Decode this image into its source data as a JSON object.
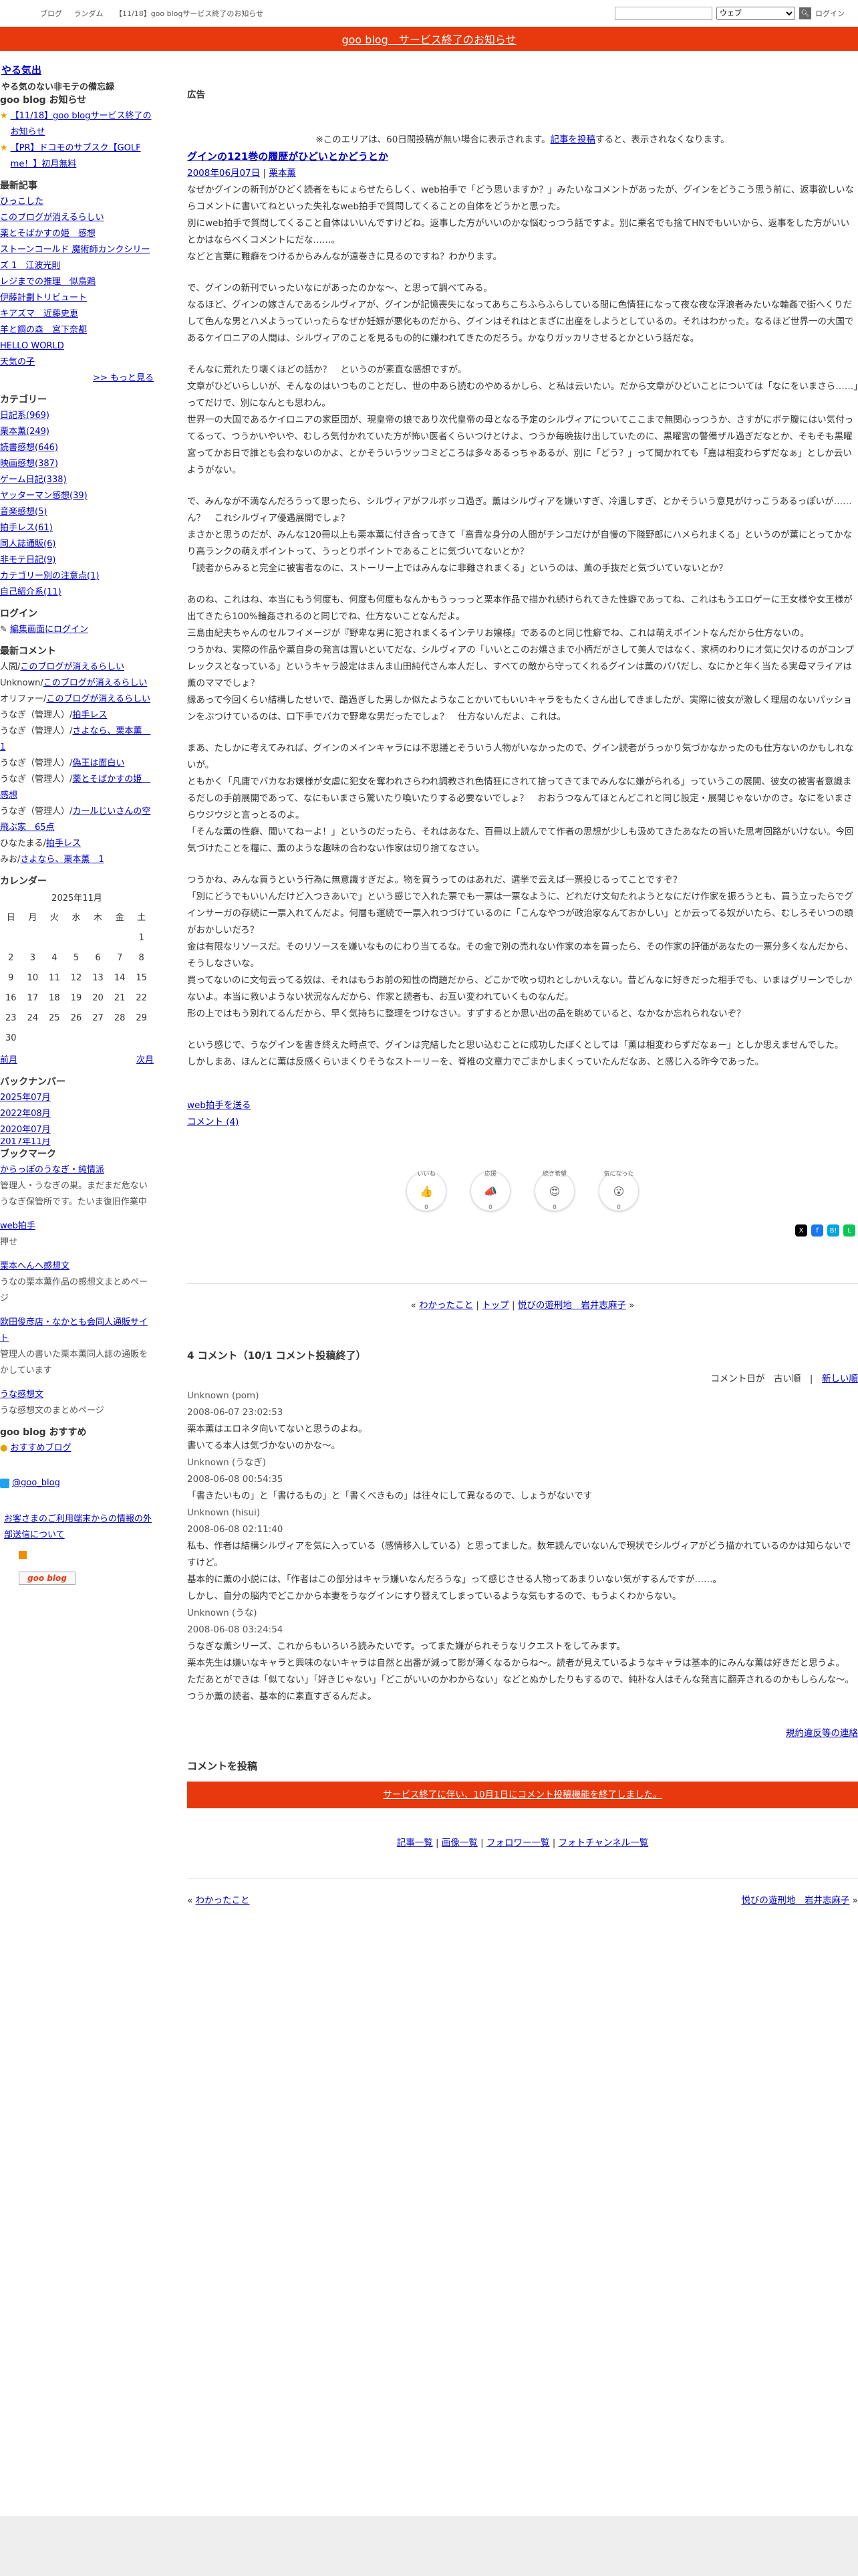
{
  "topbar": {
    "links": [
      "ブログ",
      "ランダム",
      "【11/18】goo blogサービス終了のお知らせ"
    ],
    "search_placeholder": "",
    "select_value": "ウェブ",
    "login": "ログイン"
  },
  "banner": {
    "text": "goo blog　サービス終了のお知らせ"
  },
  "blog": {
    "title": "やる気出",
    "description": "やる気のない非モテの備忘録"
  },
  "sidebar": {
    "notice_heading": "goo blog お知らせ",
    "notices": [
      "【11/18】goo blogサービス終了のお知らせ",
      "【PR】ドコモのサブスク【GOLF me！】初月無料"
    ],
    "recent_heading": "最新記事",
    "recent": [
      "ひっこした",
      "このブログが消えるらしい",
      "薬とそばかすの姫　感想",
      "ストーンコールド 魔術師カンクシリーズ 1　江波光則",
      "レジまでの推理　似鳥鶏",
      "伊藤計劃トリビュート",
      "キアズマ　近藤史恵",
      "羊と鋼の森　宮下奈都",
      "HELLO WORLD",
      "天気の子"
    ],
    "more": ">> もっと見る",
    "category_heading": "カテゴリー",
    "categories": [
      "日記系(969)",
      "栗本薫(249)",
      "読書感想(646)",
      "映画感想(387)",
      "ゲーム日記(338)",
      "ヤッターマン感想(39)",
      "音楽感想(5)",
      "拍手レス(61)",
      "同人誌通販(6)",
      "非モテ日記(9)",
      "カテゴリー別の注意点(1)",
      "自己紹介系(11)"
    ],
    "login_heading": "ログイン",
    "login_link": "編集画面にログイン",
    "comments_heading": "最新コメント",
    "comments": [
      {
        "who": "人間/",
        "link": "このブログが消えるらしい"
      },
      {
        "who": "Unknown/",
        "link": "このブログが消えるらしい"
      },
      {
        "who": "オリファー/",
        "link": "このブログが消えるらしい"
      },
      {
        "who": "うなぎ（管理人）/",
        "link": "拍手レス"
      },
      {
        "who": "うなぎ（管理人）/",
        "link": "さよなら、栗本薫　1"
      },
      {
        "who": "うなぎ（管理人）/",
        "link": "偽王は面白い"
      },
      {
        "who": "うなぎ（管理人）/",
        "link": "薬とそばかすの姫　感想"
      },
      {
        "who": "うなぎ（管理人）/",
        "link": "カールじいさんの空飛ぶ家　65点"
      },
      {
        "who": "ひなたまる/",
        "link": "拍手レス"
      },
      {
        "who": "みお/",
        "link": "さよなら、栗本薫　1"
      }
    ],
    "calendar_heading": "カレンダー",
    "calendar_month": "2025年11月",
    "calendar_days": [
      "日",
      "月",
      "火",
      "水",
      "木",
      "金",
      "土"
    ],
    "calendar_rows": [
      [
        "",
        "",
        "",
        "",
        "",
        "",
        "1"
      ],
      [
        "2",
        "3",
        "4",
        "5",
        "6",
        "7",
        "8"
      ],
      [
        "9",
        "10",
        "11",
        "12",
        "13",
        "14",
        "15"
      ],
      [
        "16",
        "17",
        "18",
        "19",
        "20",
        "21",
        "22"
      ],
      [
        "23",
        "24",
        "25",
        "26",
        "27",
        "28",
        "29"
      ],
      [
        "30",
        "",
        "",
        "",
        "",
        "",
        ""
      ]
    ],
    "prev": "前月",
    "next": "次月",
    "backnumber_heading": "バックナンバー",
    "backnumbers": [
      "2025年07月",
      "2022年08月",
      "2020年07月",
      "2017年11月"
    ],
    "bookmark_heading": "ブックマーク",
    "bookmarks": [
      {
        "link": "からっぽのうなぎ・純情派",
        "desc": "管理人・うなぎの巣。まだまだ危ないうなぎ保管所です。たいま復旧作業中"
      },
      {
        "link": "web拍手",
        "desc": "押せ"
      },
      {
        "link": "栗本へんへ感想文",
        "desc": "うなの栗本薫作品の感想文まとめページ"
      },
      {
        "link": "欧田俊彦店・なかとも会同人通販サイト",
        "desc": "管理人の書いた栗本薫同人誌の通販をかしています"
      },
      {
        "link": "うな感想文",
        "desc": "うな感想文のまとめページ"
      }
    ],
    "recommend_heading": "goo blog おすすめ",
    "recommend_link": "おすすめブログ",
    "twitter": "@goo_blog",
    "notice_link": "お客さまのご利用端末からの情報の外部送信について",
    "goo_logo": "goo blog"
  },
  "main": {
    "ad_title": "広告",
    "ad_note": "※このエリアは、60日間投稿が無い場合に表示されます。",
    "ad_note_link": "記事を投稿",
    "ad_note_tail": "すると、表示されなくなります。",
    "post_title": "グインの121巻の履歴がひどいとかどうとか",
    "post_date": "2008年06月07日",
    "post_category": "栗本薫",
    "paragraphs": [
      "なぜかグインの新刊がひどく読者をもにょらせたらしく、web拍手で「どう思いますか？」みたいなコメントがあったが、グインをどうこう思う前に、返事欲しいならコメントに書いてねといった失礼なweb拍手で質問してくることの自体をどうかと思った。\n別にweb拍手で質問してくること自体はいいんですけどね。返事した方がいいのかな悩むっつう話ですよ。別に栗名でも捨てHNでもいいから、返事をした方がいいとかはならべくコメントにだな……。\nなどと言葉に難癖をつけるからみんなが遠巻きに見るのですね？わかります。",
      "で、グインの新刊でいったいなにがあったのかな～、と思って調べてみる。\nなるほど、グインの嫁さんであるシルヴィアが、グインが記憶喪失になってあちこちふらふらしている間に色情狂になって夜な夜な浮浪者みたいな輪姦で街へくりだして色んな男とハメようっていったらなぜか妊娠が悪化ものだから、グインはそれはとまざに出産をしようとしているの。それはわかった。なるほど世界一の大国であるケイロニアの人間は、シルヴィアのことを見るもの的に嫌われてきたのだろう。かなりガッカリさせるとかという話だな。",
      "そんなに荒れたり壊くほどの話か？　というのが素直な感想ですが。\n文章がひどいらしいが、そんなのはいつものことだし、世の中あら読むのやめるかしら、と私は云いたい。だから文章がひどいことについては「なにをいまさら……」ってだけで、別になんとも思わん。\n世界一の大国であるケイロニアの家臣団が、現皇帝の娘であり次代皇帝の母となる予定のシルヴィアについてここまで無関心っつうか、さすがにボテ腹にはい気付ってるって、つうかいやいや、むしろ気付かれていた方が怖い医者くらいつけとけよ、つうか毎晩抜け出していたのに、黒曜宮の警備ザル過ぎだなとか、そもそも黒曜宮ってかお日で誰とも会わないのかよ、とかそういうツッコミどころは多々あるっちゃあるが、別に「どう？」って聞かれても「嘉は相変わらずだなぁ」としか云いようがない。",
      "で、みんなが不満なんだろうって思ったら、シルヴィアがフルボッコ過ぎ。薫はシルヴィアを嫌いすぎ、冷遇しすぎ、とかそういう意見がけっこうあるっぽいが……\nん？　これシルヴィア優遇展開でしょ？\nまさかと思うのだが、みんな120冊以上も栗本薫に付き合ってきて「高貴な身分の人間がチンコだけが自慢の下賤野郎にハメられまくる」というのが薫にとってかなり高ランクの萌えポイントって、うっとりポイントであることに気づいてないとか？\n「読者からみると完全に被害者なのに、ストーリー上ではみんなに非難されまくる」というのは、薫の手抜だと気づいていないとか？",
      "あのね、これはね、本当にもう何度も、何度も何度もなんかもうっっっと栗本作品で描かれ続けられてきた性癖であってね、これはもうエロゲーに王女様や女王様が出てきたら100%輪姦されるのと同じでね、仕方ないことなんだよ。\n三島由紀夫ちゃんのセルフイメージが『野卑な男に犯されまくるインテリお嬢様』であるのと同じ性癖でね、これは萌えポイントなんだから仕方ないの。\nつうかね、実際の作品や薫自身の発言は置いといてだな、シルヴィアの「いいとこのお嬢さまで小柄だがさして美人ではなく、家柄のわりに才気に欠けるのがコンプレックスとなっている」というキャラ設定はまんま山田純代さん本人だし、すべての敵から守ってくれるグインは薫のパパだし、なにかと年く当たる実母マライアは薫のママでしょ？\n縁あって今回くらい結構したせいで、酷過ぎした男しか似たようなことかいてもいいキャラをもたくさん出してきましたが、実際に彼女が激しく理屈のないパッションをぶつけているのは、口下手でバカで野卑な男だったでしょ？　仕方ないんだよ、これは。",
      "まあ、たしかに考えてみれば、グインのメインキャラには不思議とそういう人物がいなかったので、グイン読者がうっかり気づかなかったのも仕方ないのかもしれないが。\nともかく「凡庸でバカなお嬢様が女虐に犯女を奪われさらわれ調教され色情狂にされて捨ってきてまでみんなに嫌がられる」っていうこの展開、彼女の被害者意識まるだしの手前展開であって、なにもいまさら驚いたり喚いたりする必要ないでしょ？　おおうつなんてほとんどこれと同じ設定・展開じゃないかのさ。なにをいまさらウジウジと言っとるのよ。\n「そんな薫の性癖、聞いてねーよ！」というのだったら、それはあなた、百冊以上読んでて作者の思想が少しも汲めてきたあなたの旨いた思考回路がいけない。今回気づけたことを糧に、薫のような趣味の合わない作家は切り捨てなさい。",
      "つうかね、みんな買うという行為に無意識すぎだよ。物を買うってのはあれだ、選挙で云えば一票投じるってことですぞ？\n「別にどうでもいいんだけど入つきあいで」という感じで入れた票でも一票は一票なように、どれだけ文句たれようとなにだけ作家を振ろうとも、買う立ったらでグインサーガの存続に一票入れてんだよ。何層も運続で一票入れつづけているのに「こんなやつが政治家なんておかしい」とか云ってる奴がいたら、むしろそいつの頭がおかしいだろ？\n金は有限なリソースだ。そのリソースを嫌いなものにわり当てるな。その金で別の売れない作家の本を買ったら、その作家の評価があなたの一票分多くなんだから、そうしなさいな。\n買ってないのに文句云ってる奴は、それはもうお前の知性の問題だから、どこかで吹っ切れとしかいえない。昔どんなに好きだった相手でも、いまはグリーンでしかないよ。本当に救いようない状況なんだから、作家と読者も、お互い変われていくものなんだ。\n形の上ではもう別れてるんだから、早く気持ちに整理をつけなさい。すずするとか思い出の品を眺めていると、なかなか忘れられないぞ？",
      "という感じで、うなグインを書き終えた時点で、グインは完結したと思い込むことに成功したぼくとしては「薫は相変わらずだなぁー」としか思えませんでした。\nしかしまあ、ほんとに薫は反感くらいまくりそうなストーリーを、脊椎の文章力でごまかしまくっていたんだなあ、と感じ入る昨今であった。"
    ],
    "webclap": "web拍手を送る",
    "comment_link": "コメント (4)",
    "reactions": [
      {
        "label": "いいね",
        "emoji": "👍",
        "count": "0"
      },
      {
        "label": "応援",
        "emoji": "📣",
        "count": "0"
      },
      {
        "label": "続き希望",
        "emoji": "😍",
        "count": "0"
      },
      {
        "label": "気になった",
        "emoji": "😮",
        "count": "0"
      }
    ],
    "pager": {
      "prev": "わかったこと",
      "top": "トップ",
      "next": "悦びの遊刑地　岩井志麻子"
    },
    "comments_title": "4 コメント（10/1 コメント投稿終了）",
    "order_label": "コメント日が",
    "order_old": "古い順",
    "order_new": "新しい順",
    "comments": [
      {
        "who": "Unknown (pom)",
        "date": "2008-06-07 23:02:53",
        "text": "栗本薫はエロネタ向いてないと思うのよね。\n書いてる本人は気づかないのかな～。"
      },
      {
        "who": "Unknown (うなぎ)",
        "date": "2008-06-08 00:54:35",
        "text": "「書きたいもの」と「書けるもの」と「書くべきもの」は往々にして異なるので、しょうがないです"
      },
      {
        "who": "Unknown (hisui)",
        "date": "2008-06-08 02:11:40",
        "text": "私も、作者は結構シルヴィアを気に入っている（感情移入している）と思ってました。数年読んでいないんで現状でシルヴィアがどう描かれているのかは知らないですけど。\n基本的に薫の小説には、「作者はこの部分はキャラ嫌いなんだろうな」って感じさせる人物ってあまりいない気がするんですが……。\nしかし、自分の脳内でどこかから本妻をうなグインにすり替えてしまっているような気もするので、もうよくわからない。"
      },
      {
        "who": "Unknown (うな)",
        "date": "2008-06-08 03:24:54",
        "text": "うなぎな薫シリーズ、これからもいろいろ読みたいです。ってまた嫌がられそうなリクエストをしてみます。\n栗本先生は嫌いなキャラと興味のないキャラは自然と出番が減って影が薄くなるからね～。読者が見えているようなキャラは基本的にみんな薫は好きだと思うよ。\nただあとができは「似てない」「好きじゃない」「どこがいいのかわからない」などとぬかしたりもするので、純朴な人はそんな発言に翻弄されるのかもしらんな～。\nつうか薫の読者、基本的に素直すぎるんだよ。"
      }
    ],
    "report_link": "規約違反等の連絡",
    "post_comment_heading": "コメントを投稿",
    "post_comment_notice": "サービス終了に伴い、10月1日にコメント投稿機能を終了しました。",
    "footer_links": [
      "記事一覧",
      "画像一覧",
      "フォロワー一覧",
      "フォトチャンネル一覧"
    ],
    "bottom_prev": "わかったこと",
    "bottom_next": "悦びの遊刑地　岩井志麻子"
  }
}
